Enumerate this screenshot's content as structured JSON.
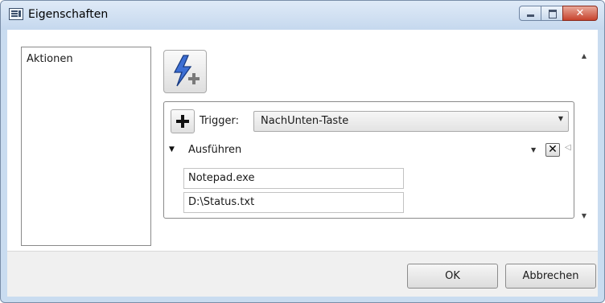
{
  "window": {
    "title": "Eigenschaften",
    "icon": "properties-window-icon",
    "controls": {
      "minimize": "minimize-icon",
      "maximize": "maximize-icon",
      "close_glyph": "✕"
    }
  },
  "sidebar": {
    "items": [
      {
        "label": "Aktionen"
      }
    ]
  },
  "toolbar": {
    "add_action_icon": "lightning-add-icon"
  },
  "trigger": {
    "add_icon": "plus-icon",
    "label": "Trigger:",
    "selected": "NachUnten-Taste"
  },
  "action": {
    "expander_glyph": "▼",
    "label": "Ausführen",
    "dropdown_glyph": "▼",
    "remove_glyph": "✕",
    "parameters": [
      {
        "value": "Notepad.exe"
      },
      {
        "value": "D:\\Status.txt"
      }
    ]
  },
  "buttons": {
    "ok": "OK",
    "cancel": "Abbrechen"
  },
  "colors": {
    "frame": "#c9dcf0",
    "close_button": "#c7432d",
    "lightning": "#3d6fd4"
  }
}
